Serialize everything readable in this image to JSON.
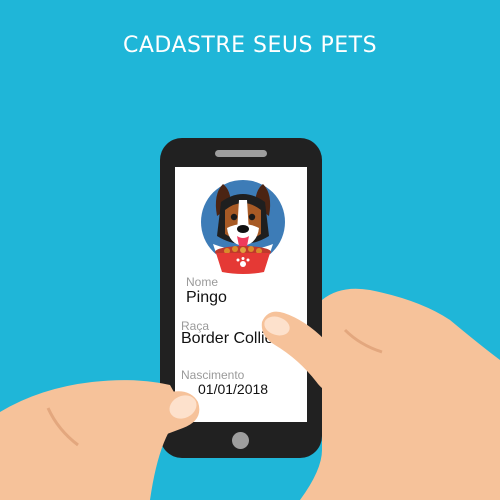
{
  "header": {
    "title": "CADASTRE SEUS PETS"
  },
  "colors": {
    "background": "#1fb6d8",
    "phone": "#212121",
    "skin": "#f6c29a",
    "bowl": "#e53935"
  },
  "avatar": {
    "icon": "dog-with-food-bowl-icon"
  },
  "form": {
    "name_label": "Nome",
    "name_value": "Pingo",
    "breed_label": "Raça",
    "breed_value": "Border Collie",
    "birth_label": "Nascimento",
    "birth_value": "01/01/2018"
  }
}
